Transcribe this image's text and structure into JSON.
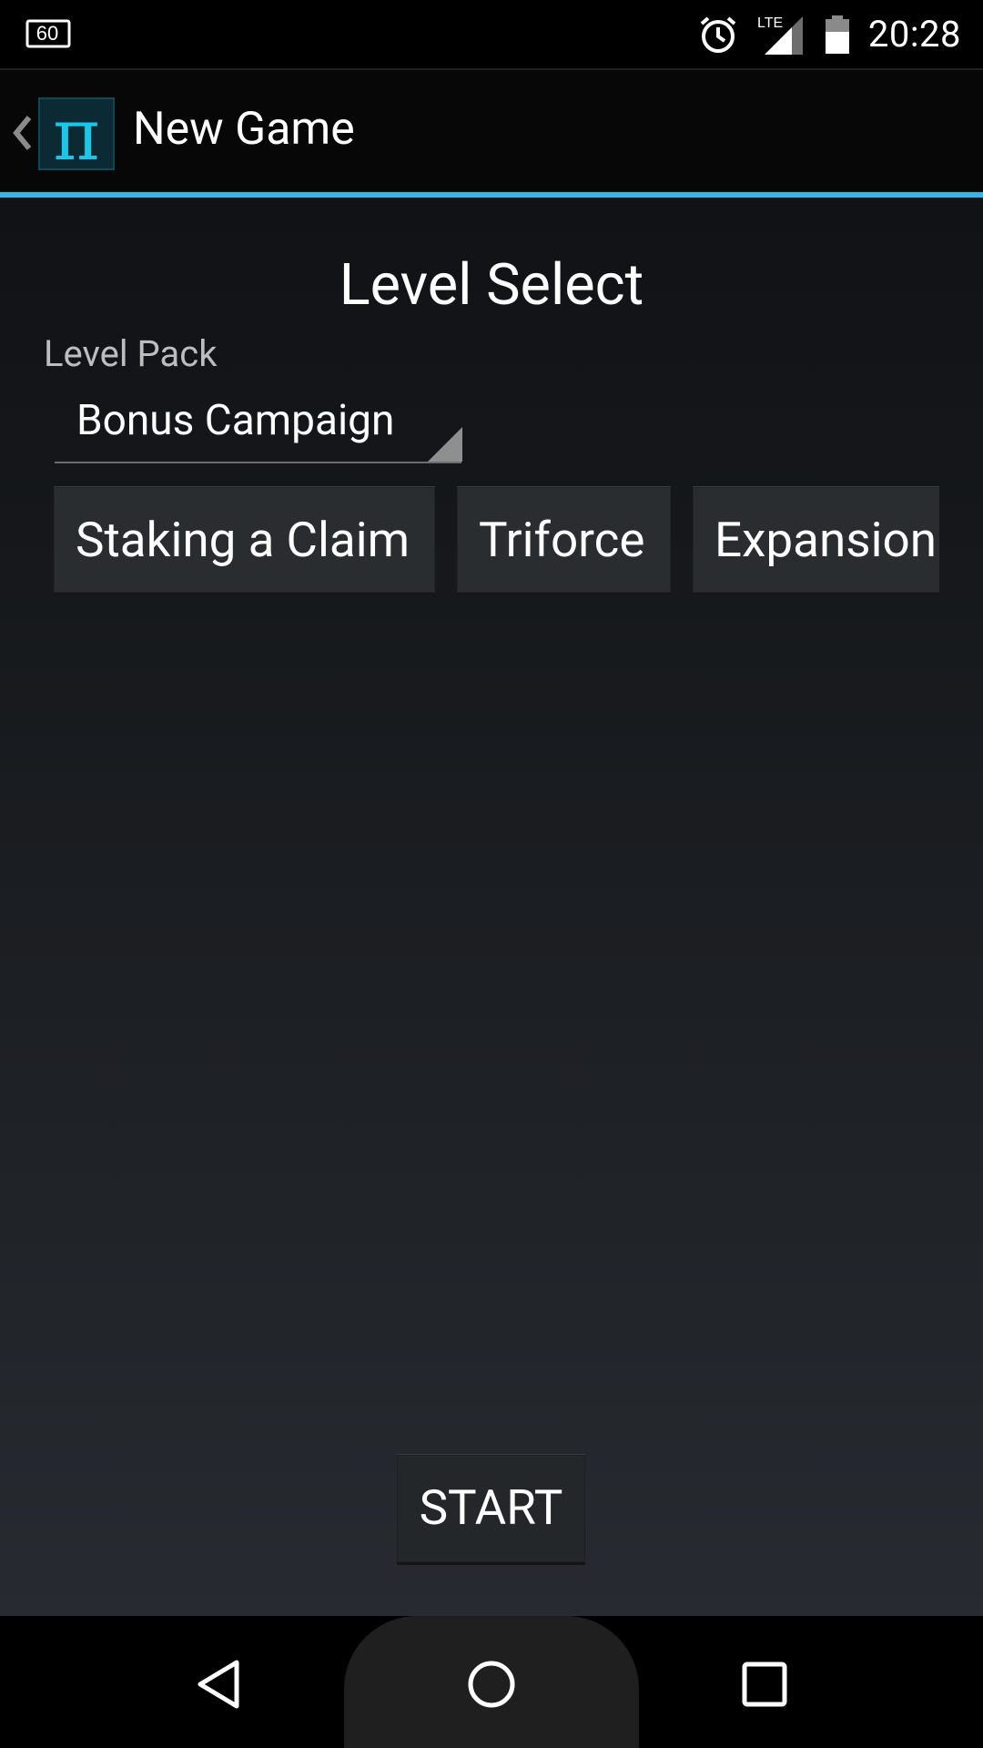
{
  "status_bar": {
    "left_icon": "fps-60-icon",
    "left_icon_text": "60",
    "icons": [
      "alarm-icon",
      "lte-signal-icon",
      "battery-icon"
    ],
    "network_label": "LTE",
    "time": "20:28"
  },
  "action_bar": {
    "title": "New Game",
    "app_icon": "pi-icon",
    "app_icon_glyph": "π",
    "accent_color": "#33b5e5"
  },
  "main": {
    "heading": "Level Select",
    "level_pack_label": "Level Pack",
    "level_pack_selected": "Bonus Campaign",
    "levels": [
      {
        "label": "Staking a Claim"
      },
      {
        "label": "Triforce"
      },
      {
        "label": "Expansion"
      }
    ],
    "start_label": "START"
  },
  "nav_bar": {
    "buttons": [
      "back-icon",
      "home-icon",
      "recents-icon"
    ]
  }
}
